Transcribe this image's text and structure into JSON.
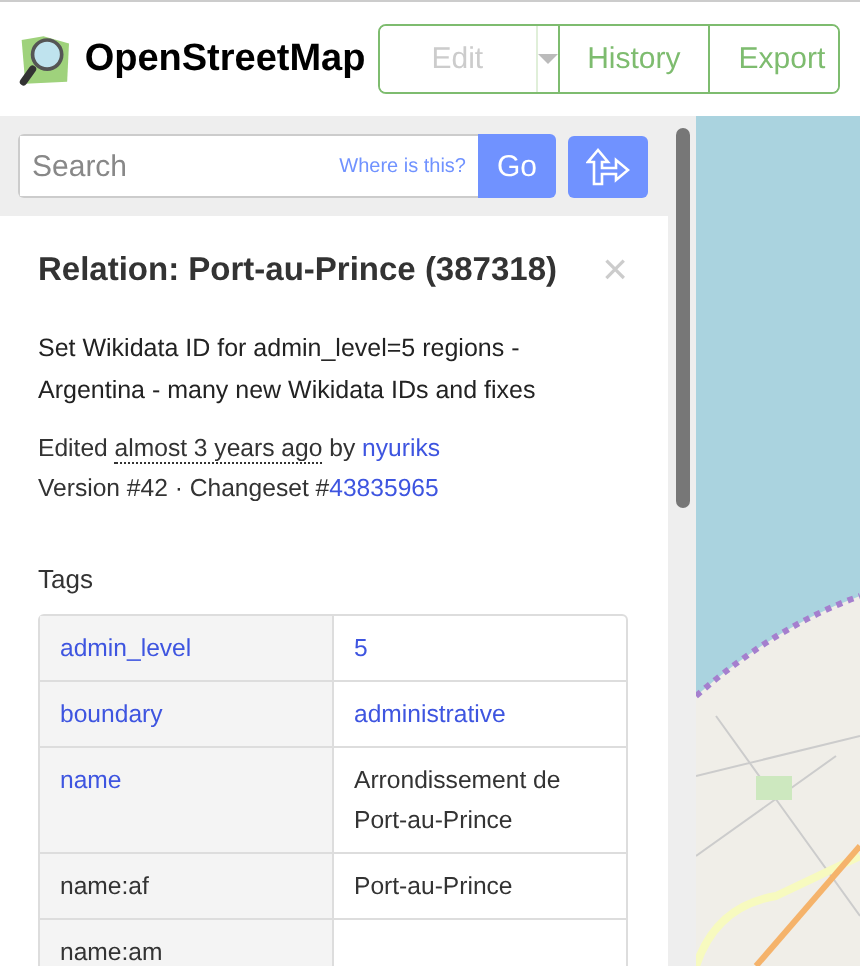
{
  "header": {
    "logo_text": "OpenStreetMap",
    "buttons": [
      {
        "label": "Edit",
        "disabled": true,
        "kind": "split"
      },
      {
        "label": "History",
        "disabled": false,
        "kind": "plain"
      },
      {
        "label": "Export",
        "disabled": false,
        "kind": "plain"
      }
    ]
  },
  "search": {
    "placeholder": "Search",
    "where_link": "Where is this?",
    "go": "Go"
  },
  "panel": {
    "title": "Relation: Port-au-Prince (387318)",
    "close": "×",
    "comment": "Set Wikidata ID for admin_level=5 regions - Argentina - many new Wikidata IDs and fixes",
    "edited_prefix": "Edited",
    "edited_time": "almost 3 years ago",
    "edited_by": "by",
    "user": "nyuriks",
    "version": "Version #42 · Changeset #",
    "changeset": "43835965",
    "tags_heading": "Tags"
  },
  "tags": [
    {
      "key": "admin_level",
      "value": "5",
      "key_link": true,
      "value_link": true
    },
    {
      "key": "boundary",
      "value": "administrative",
      "key_link": true,
      "value_link": true
    },
    {
      "key": "name",
      "value": "Arrondissement de Port-au-Prince",
      "key_link": true,
      "value_link": false
    },
    {
      "key": "name:af",
      "value": "Port-au-Prince",
      "key_link": false,
      "value_link": false
    },
    {
      "key": "name:am",
      "key_link": false
    }
  ]
}
